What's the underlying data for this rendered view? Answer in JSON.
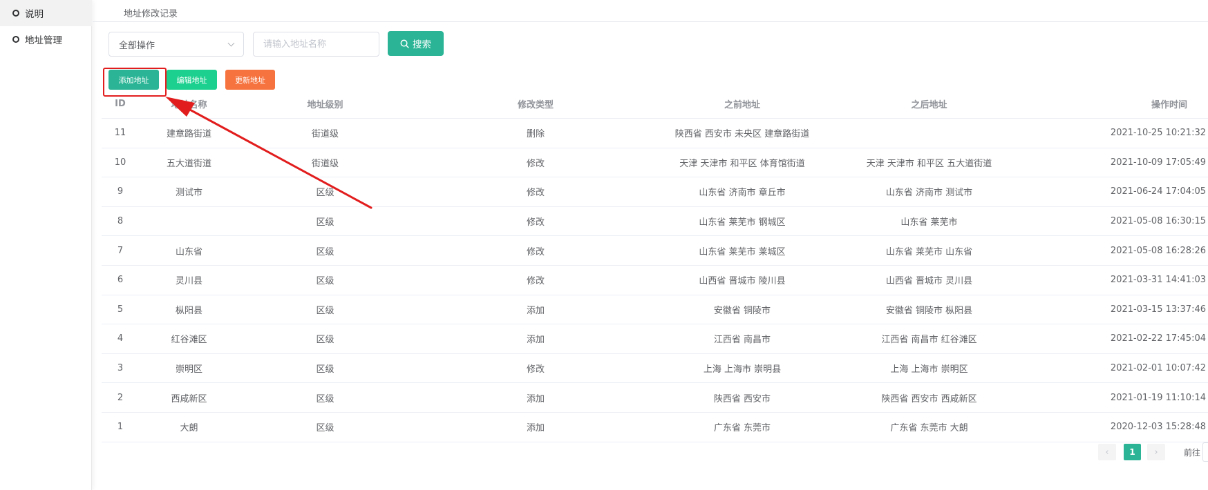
{
  "sidebar": {
    "items": [
      {
        "label": "说明",
        "active": true
      },
      {
        "label": "地址管理",
        "active": false
      }
    ]
  },
  "tab": {
    "title": "地址修改记录"
  },
  "filter": {
    "select_value": "全部操作",
    "input_placeholder": "请输入地址名称",
    "input_value": "",
    "search_label": "搜索"
  },
  "actions": {
    "add_label": "添加地址",
    "edit_label": "编辑地址",
    "update_label": "更新地址"
  },
  "table": {
    "headers": {
      "id": "ID",
      "name": "地址名称",
      "level": "地址级别",
      "type": "修改类型",
      "before": "之前地址",
      "after": "之后地址",
      "time": "操作时间"
    },
    "rows": [
      {
        "id": "11",
        "name": "建章路街道",
        "level": "街道级",
        "type": "删除",
        "before": "陕西省 西安市 未央区 建章路街道",
        "after": "",
        "time": "2021-10-25 10:21:32"
      },
      {
        "id": "10",
        "name": "五大道街道",
        "level": "街道级",
        "type": "修改",
        "before": "天津 天津市 和平区 体育馆街道",
        "after": "天津 天津市 和平区 五大道街道",
        "time": "2021-10-09 17:05:49"
      },
      {
        "id": "9",
        "name": "测试市",
        "level": "区级",
        "type": "修改",
        "before": "山东省 济南市 章丘市",
        "after": "山东省 济南市 测试市",
        "time": "2021-06-24 17:04:05"
      },
      {
        "id": "8",
        "name": "",
        "level": "区级",
        "type": "修改",
        "before": "山东省 莱芜市 钢城区",
        "after": "山东省 莱芜市",
        "time": "2021-05-08 16:30:15"
      },
      {
        "id": "7",
        "name": "山东省",
        "level": "区级",
        "type": "修改",
        "before": "山东省 莱芜市 莱城区",
        "after": "山东省 莱芜市 山东省",
        "time": "2021-05-08 16:28:26"
      },
      {
        "id": "6",
        "name": "灵川县",
        "level": "区级",
        "type": "修改",
        "before": "山西省 晋城市 陵川县",
        "after": "山西省 晋城市 灵川县",
        "time": "2021-03-31 14:41:03"
      },
      {
        "id": "5",
        "name": "枞阳县",
        "level": "区级",
        "type": "添加",
        "before": "安徽省 铜陵市",
        "after": "安徽省 铜陵市 枞阳县",
        "time": "2021-03-15 13:37:46"
      },
      {
        "id": "4",
        "name": "红谷滩区",
        "level": "区级",
        "type": "添加",
        "before": "江西省 南昌市",
        "after": "江西省 南昌市 红谷滩区",
        "time": "2021-02-22 17:45:04"
      },
      {
        "id": "3",
        "name": "崇明区",
        "level": "区级",
        "type": "修改",
        "before": "上海 上海市 崇明县",
        "after": "上海 上海市 崇明区",
        "time": "2021-02-01 10:07:42"
      },
      {
        "id": "2",
        "name": "西咸新区",
        "level": "区级",
        "type": "添加",
        "before": "陕西省 西安市",
        "after": "陕西省 西安市 西咸新区",
        "time": "2021-01-19 11:10:14"
      },
      {
        "id": "1",
        "name": "大朗",
        "level": "区级",
        "type": "添加",
        "before": "广东省 东莞市",
        "after": "广东省 东莞市 大朗",
        "time": "2020-12-03 15:28:48"
      }
    ]
  },
  "pagination": {
    "prev": "‹",
    "current": "1",
    "next": "›",
    "goto_label": "前往"
  },
  "colors": {
    "primary": "#2bb596",
    "edit": "#1cd08f",
    "update": "#f6733f",
    "annotation": "#e21d1d"
  }
}
